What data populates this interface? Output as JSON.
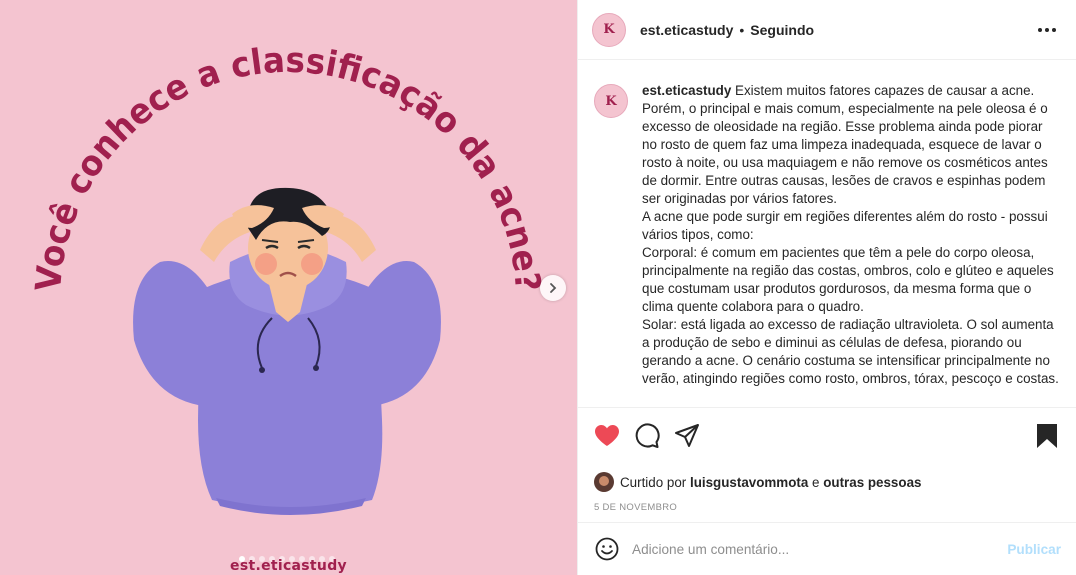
{
  "media": {
    "headline": "Você conhece a classificação da acne?",
    "brand": "est.eticastudy",
    "slide_count": 10,
    "active_slide": 0,
    "colors": {
      "background": "#f4c4d0",
      "title": "#a0204e",
      "hoodie": "#8c80d8",
      "hair": "#1e1e24",
      "skin": "#f6c29a"
    }
  },
  "header": {
    "avatar_letter": "K",
    "username": "est.eticastudy",
    "separator": "•",
    "follow_status": "Seguindo"
  },
  "caption": {
    "username": "est.eticastudy",
    "text": "Existem muitos fatores capazes de causar a acne. Porém, o principal e mais comum, especialmente na pele oleosa é o excesso de oleosidade na região. Esse problema ainda pode piorar no rosto de quem faz uma limpeza inadequada, esquece de lavar o rosto à noite, ou usa maquiagem e não remove os cosméticos antes de dormir. Entre outras causas, lesões de cravos e espinhas podem ser originadas por vários fatores.",
    "para2": "A acne que pode surgir em regiões diferentes além do rosto - possui vários tipos, como:",
    "para3": "Corporal: é comum em pacientes que têm a pele do corpo oleosa, principalmente na região das costas, ombros, colo e glúteo e aqueles que costumam usar produtos gordurosos, da mesma forma que o clima quente colabora para o quadro.",
    "para4": "Solar: está ligada ao excesso de radiação ultravioleta. O sol aumenta a produção de sebo e diminui as células de defesa, piorando ou gerando a acne. O cenário costuma se intensificar principalmente no verão, atingindo regiões como rosto, ombros, tórax, pescoço e costas."
  },
  "likes": {
    "prefix": "Curtido por",
    "user": "luisgustavommota",
    "connector": "e",
    "others": "outras pessoas"
  },
  "date": "5 DE NOVEMBRO",
  "comment": {
    "placeholder": "Adicione um comentário...",
    "publish_label": "Publicar"
  },
  "icons": {
    "like": "heart-icon",
    "comment": "comment-icon",
    "share": "share-icon",
    "save": "bookmark-icon",
    "emoji": "emoji-icon",
    "next": "chevron-right-icon",
    "more": "more-options-icon"
  },
  "accent": {
    "like": "#ed4956",
    "publish": "#b2dffc"
  }
}
